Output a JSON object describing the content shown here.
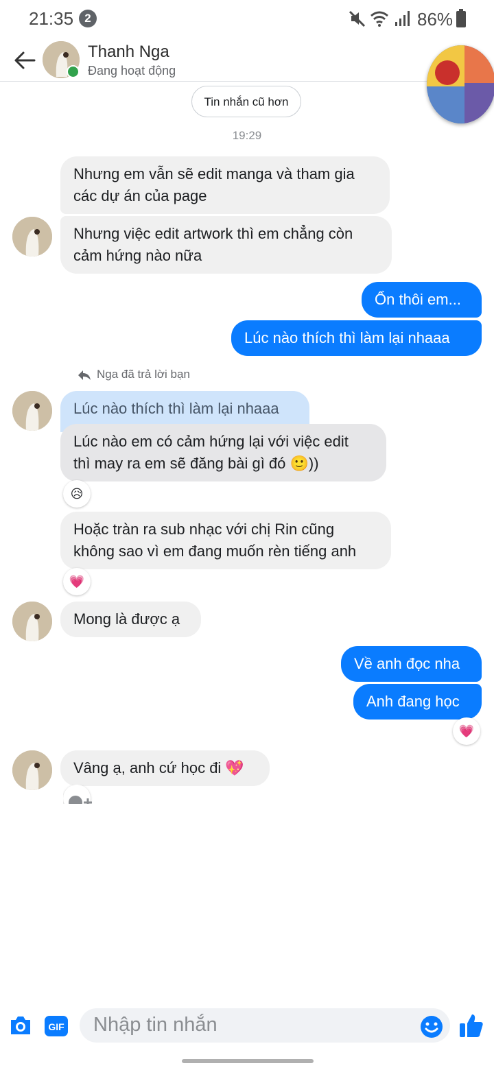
{
  "status_bar": {
    "time": "21:35",
    "notification_count": "2",
    "battery": "86%"
  },
  "header": {
    "contact_name": "Thanh Nga",
    "contact_status": "Đang hoạt động"
  },
  "older_messages_label": "Tin nhắn cũ hơn",
  "timestamp": "19:29",
  "reply_note": "Nga đã trả lời bạn",
  "messages": [
    {
      "text": "Nhưng em vẫn sẽ edit manga và tham gia\ncác dự án của page"
    },
    {
      "text": "Nhưng việc edit artwork thì em chẳng còn\ncảm hứng nào nữa"
    },
    {
      "text": "Ổn thôi em..."
    },
    {
      "text": "Lúc nào thích thì làm lại nhaaa"
    },
    {
      "text": "Lúc nào thích thì làm lại nhaaa"
    },
    {
      "text": "Lúc nào em có cảm hứng lại với việc edit\nthì may ra em sẽ đăng bài gì đó 🙂))"
    },
    {
      "text": "Hoặc tràn ra sub nhạc với chị Rin cũng\nkhông sao vì em đang muốn rèn tiếng anh"
    },
    {
      "text": "Mong là được ạ"
    },
    {
      "text": "Về anh đọc nha"
    },
    {
      "text": "Anh đang học"
    },
    {
      "text": "Vâng ạ, anh cứ học đi 💖"
    }
  ],
  "composer": {
    "placeholder": "Nhập tin nhắn"
  },
  "colors": {
    "accent": "#0a7cff",
    "incoming_bubble": "#f0f0f0",
    "quoted_bubble": "#cfe4fb",
    "online": "#31a24c"
  },
  "icons": [
    "back-arrow-icon",
    "mute-icon",
    "wifi-icon",
    "signal-icon",
    "battery-icon",
    "camera-icon",
    "gif-icon",
    "emoji-icon",
    "thumbs-up-icon",
    "reply-icon"
  ]
}
